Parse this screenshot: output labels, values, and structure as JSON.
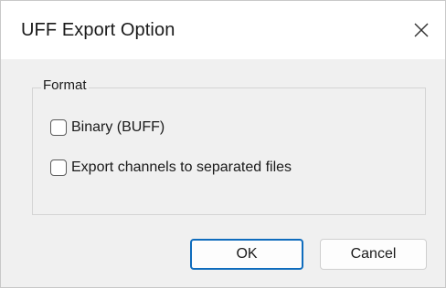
{
  "window": {
    "title": "UFF Export Option",
    "close_icon": "close-icon"
  },
  "format_group": {
    "legend": "Format",
    "options": [
      {
        "label": "Binary (BUFF)",
        "checked": false
      },
      {
        "label": "Export channels to separated files",
        "checked": false
      }
    ]
  },
  "buttons": {
    "ok_label": "OK",
    "cancel_label": "Cancel"
  },
  "colors": {
    "accent": "#0f6cbd",
    "dialog_background": "#f0f0f0",
    "titlebar_background": "#ffffff"
  }
}
